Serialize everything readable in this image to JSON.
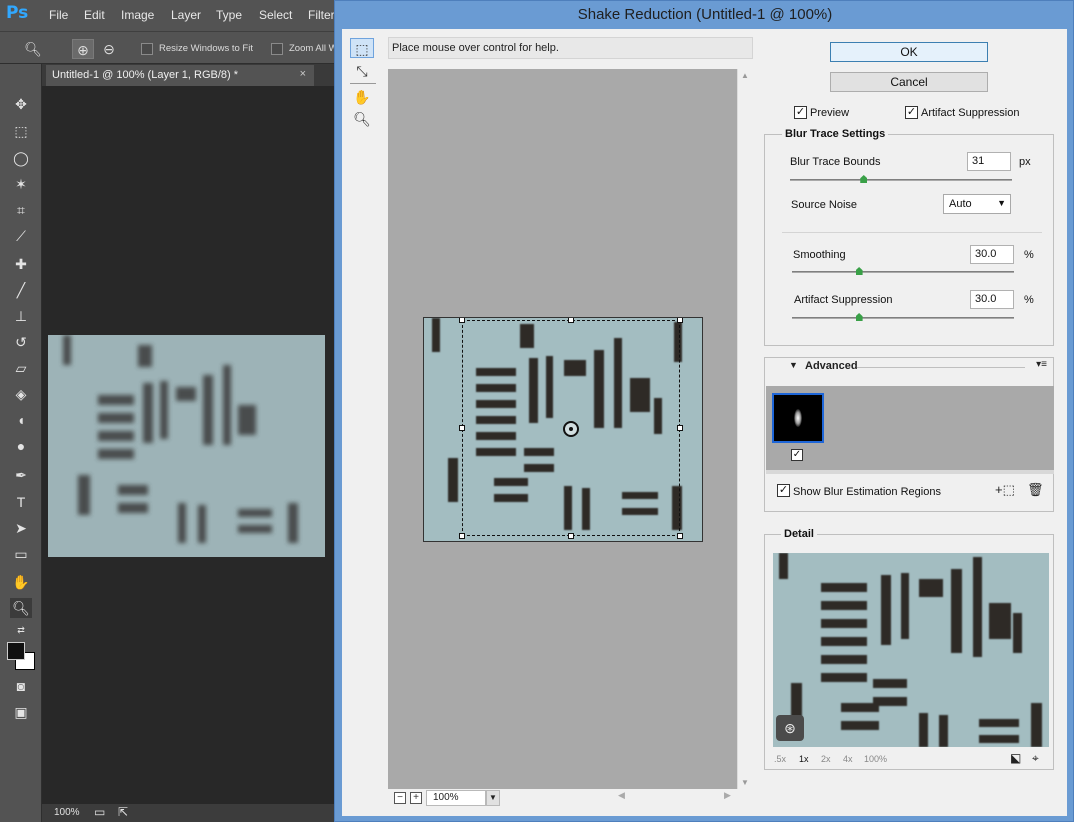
{
  "app": {
    "logo": "Ps",
    "menus": [
      "File",
      "Edit",
      "Image",
      "Layer",
      "Type",
      "Select",
      "Filter"
    ],
    "options": {
      "resize_windows_label": "Resize Windows to Fit",
      "zoom_all_label": "Zoom All W"
    },
    "document_tab": "Untitled-1 @ 100% (Layer 1, RGB/8) *",
    "tab_close": "×",
    "status_zoom": "100%"
  },
  "dialog": {
    "title": "Shake Reduction (Untitled-1 @ 100%)",
    "help_text": "Place mouse over control for help.",
    "zoom": {
      "minus": "−",
      "plus": "+",
      "value": "100%"
    },
    "buttons": {
      "ok": "OK",
      "cancel": "Cancel"
    },
    "preview": {
      "label": "Preview",
      "checked": true
    },
    "artifact_suppression_toggle": {
      "label": "Artifact Suppression",
      "checked": true
    },
    "blur_trace": {
      "title": "Blur Trace Settings",
      "bounds_label": "Blur Trace Bounds",
      "bounds_value": "31",
      "bounds_unit": "px",
      "source_noise_label": "Source Noise",
      "source_noise_value": "Auto",
      "smoothing_label": "Smoothing",
      "smoothing_value": "30.0",
      "smoothing_unit": "%",
      "artifact_label": "Artifact Suppression",
      "artifact_value": "30.0",
      "artifact_unit": "%"
    },
    "sliders": {
      "bounds_fraction": 0.33,
      "smoothing_fraction": 0.3,
      "artifact_fraction": 0.3
    },
    "advanced": {
      "title": "Advanced",
      "show_regions_label": "Show Blur Estimation Regions",
      "show_regions_checked": true,
      "kernel_checked": true
    },
    "detail": {
      "title": "Detail",
      "zoom_levels": [
        ".5x",
        "1x",
        "2x",
        "4x",
        "100%"
      ],
      "active_zoom": "1x"
    },
    "check_mark": "✓"
  },
  "colors": {
    "dialog_frame": "#6a9bd3",
    "photoshop_panel": "#535353",
    "photoshop_logo": "#31a8ff",
    "image_tint": "#a3bdc1",
    "slider_thumb": "#39a047",
    "selection_blue": "#1e66d8"
  },
  "icons": {
    "ps_tools": [
      "move-icon",
      "marquee-icon",
      "lasso-icon",
      "magic-wand-icon",
      "crop-icon",
      "eyedropper-icon",
      "healing-brush-icon",
      "brush-icon",
      "clone-stamp-icon",
      "history-brush-icon",
      "eraser-icon",
      "paint-bucket-icon",
      "blur-icon",
      "dodge-icon",
      "pen-icon",
      "type-icon",
      "path-selection-icon",
      "rectangle-icon",
      "hand-icon",
      "zoom-icon"
    ],
    "dialog_tools": [
      "blur-estimation-tool-icon",
      "blur-direction-tool-icon",
      "hand-tool-icon",
      "zoom-tool-icon"
    ]
  }
}
